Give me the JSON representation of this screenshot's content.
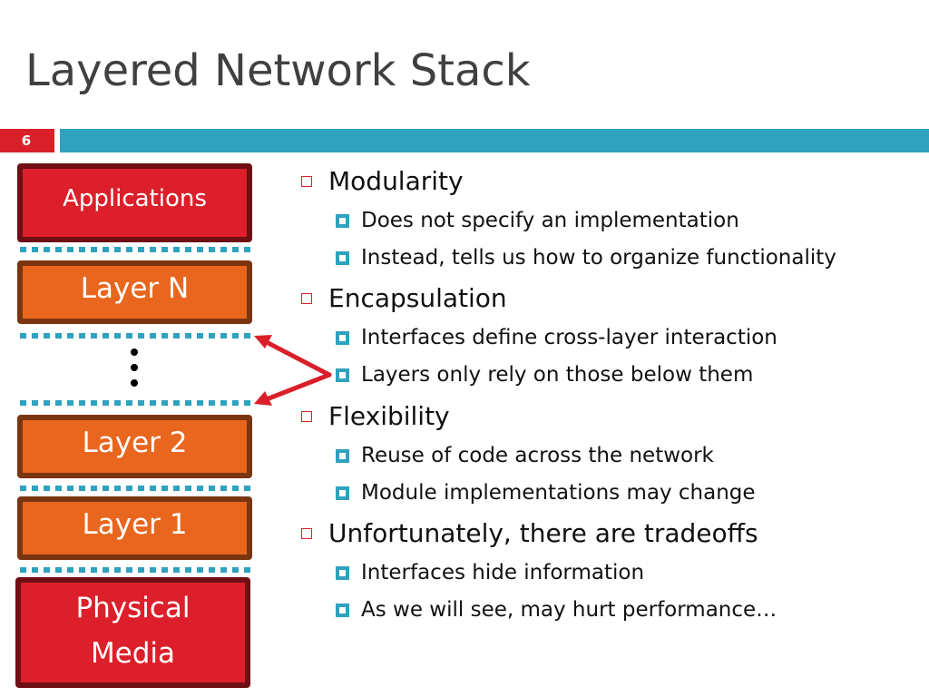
{
  "slide": {
    "title": "Layered Network Stack",
    "number": "6"
  },
  "stack": {
    "layers": [
      {
        "label": "Applications",
        "kind": "red"
      },
      {
        "label": "Layer N",
        "kind": "orange"
      },
      {
        "label": "Layer 2",
        "kind": "orange"
      },
      {
        "label": "Layer 1",
        "kind": "orange"
      },
      {
        "label": "Physical\nMedia",
        "kind": "red"
      }
    ],
    "ellipsis": "vertical-dots",
    "colors": {
      "red_fill": "#dc1f2a",
      "red_border": "#6e0f14",
      "orange_fill": "#e8661e",
      "orange_border": "#7a3510",
      "separator": "#2ea2bf",
      "arrow": "#d9202a"
    }
  },
  "bullets": [
    {
      "text": "Modularity",
      "sub": [
        "Does not specify an implementation",
        "Instead, tells us how to organize functionality"
      ]
    },
    {
      "text": "Encapsulation",
      "sub": [
        "Interfaces define cross-layer interaction",
        "Layers only rely on those below them"
      ]
    },
    {
      "text": "Flexibility",
      "sub": [
        "Reuse of code across the network",
        "Module implementations may change"
      ]
    },
    {
      "text": "Unfortunately, there are tradeoffs",
      "sub": [
        "Interfaces hide information",
        "As we will see, may hurt performance…"
      ]
    }
  ],
  "theme": {
    "accent_red": "#d9202a",
    "accent_blue": "#2ea2bf",
    "title_color": "#404040"
  }
}
